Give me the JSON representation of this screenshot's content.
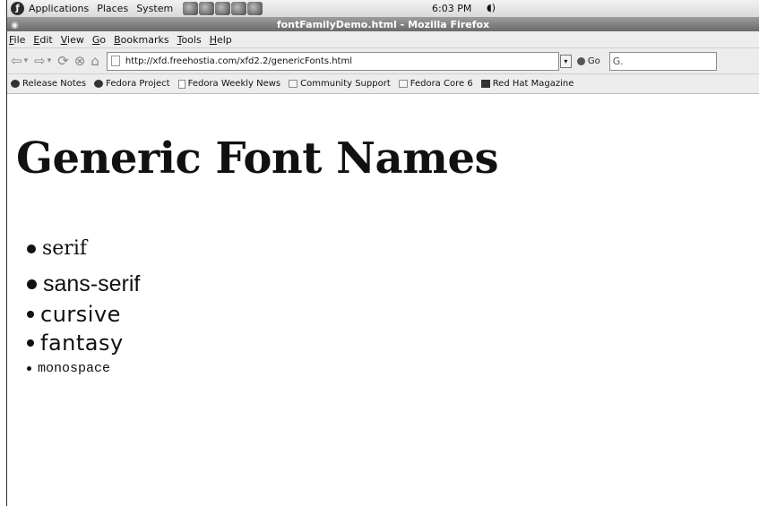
{
  "gnome_panel": {
    "menus": [
      "Applications",
      "Places",
      "System"
    ],
    "clock": "6:03 PM"
  },
  "window": {
    "title": "fontFamilyDemo.html - Mozilla Firefox"
  },
  "menubar": {
    "items": [
      {
        "accel": "F",
        "rest": "ile"
      },
      {
        "accel": "E",
        "rest": "dit"
      },
      {
        "accel": "V",
        "rest": "iew"
      },
      {
        "accel": "G",
        "rest": "o"
      },
      {
        "accel": "B",
        "rest": "ookmarks"
      },
      {
        "accel": "T",
        "rest": "ools"
      },
      {
        "accel": "H",
        "rest": "elp"
      }
    ]
  },
  "navbar": {
    "url": "http://xfd.freehostia.com/xfd2.2/genericFonts.html",
    "go_label": "Go",
    "search_value": "G."
  },
  "bookmarks": [
    {
      "label": "Release Notes",
      "icon": "fedora-icon"
    },
    {
      "label": "Fedora Project",
      "icon": "fedora-icon"
    },
    {
      "label": "Fedora Weekly News",
      "icon": "document-icon"
    },
    {
      "label": "Community Support",
      "icon": "folder-icon"
    },
    {
      "label": "Fedora Core 6",
      "icon": "folder-icon"
    },
    {
      "label": "Red Hat Magazine",
      "icon": "redhat-icon"
    }
  ],
  "page": {
    "heading": "Generic Font Names",
    "fonts": [
      "serif",
      "sans-serif",
      "cursive",
      "fantasy",
      "monospace"
    ]
  }
}
